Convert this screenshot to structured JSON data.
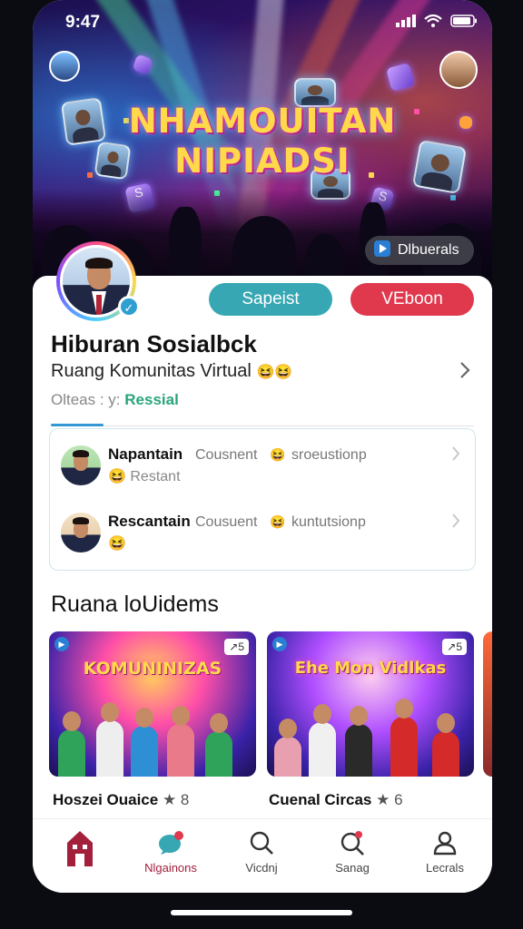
{
  "status_bar": {
    "time": "9:47"
  },
  "hero": {
    "title_line1": "NHAMOUITAN",
    "title_line2": "NIPIADSI",
    "badge_label": "Dlbuerals"
  },
  "profile": {
    "follow_label": "Sapeist",
    "video_label": "VEboon",
    "name": "Hiburan Sosialbck",
    "description": "Ruang Komunitas Virtual",
    "description_emoji": "😆😆",
    "meta_prefix": "Olteas : y:",
    "meta_highlight": "Ressial"
  },
  "list": [
    {
      "title": "Napantain",
      "subtitle": "Cousnent",
      "emoji": "😆",
      "extra": "sroeustionp",
      "line2": "😆 Restant"
    },
    {
      "title": "Rescantain",
      "subtitle": "Cousuent",
      "emoji": "😆",
      "extra": "kuntutsionp",
      "line2": "😆"
    }
  ],
  "section": {
    "title": "Ruana loUidems",
    "cards": [
      {
        "thumb_title": "KOMUNINIZAS",
        "count": "↗5",
        "caption": "Hoszei Ouaice",
        "caption_suffix": "★ 8"
      },
      {
        "thumb_title": "Ehe Mon Vidlkas",
        "count": "↗5",
        "caption": "Cuenal Circas",
        "caption_suffix": "★ 6"
      }
    ]
  },
  "nav": [
    {
      "label": "",
      "icon": "home-icon"
    },
    {
      "label": "Nlgainons",
      "icon": "chat-bubble-icon"
    },
    {
      "label": "Vicdnj",
      "icon": "search-icon"
    },
    {
      "label": "Sanag",
      "icon": "search-notification-icon"
    },
    {
      "label": "Lecrals",
      "icon": "profile-icon"
    }
  ],
  "colors": {
    "follow": "#36a7b3",
    "video": "#e0384d",
    "accent": "#3597d3",
    "nav_active": "#a3203c"
  }
}
